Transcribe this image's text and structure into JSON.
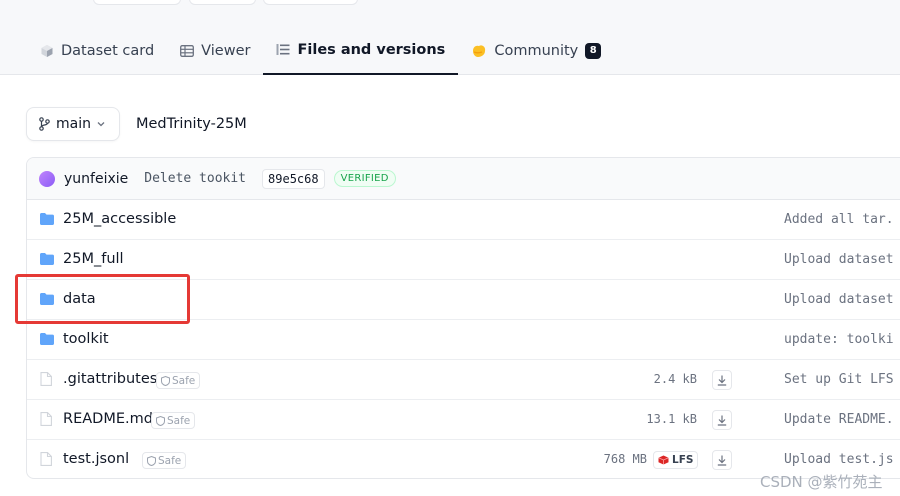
{
  "tabs": [
    {
      "label": "Dataset card",
      "icon": "dataset-card-icon",
      "active": false
    },
    {
      "label": "Viewer",
      "icon": "viewer-table-icon",
      "active": false
    },
    {
      "label": "Files and versions",
      "icon": "files-versions-icon",
      "active": true
    },
    {
      "label": "Community",
      "icon": "community-icon",
      "active": false,
      "badge": "8"
    }
  ],
  "branch": {
    "label": "main",
    "icon": "branch-icon"
  },
  "repo": {
    "name": "MedTrinity-25M"
  },
  "commit": {
    "author": "yunfeixie",
    "message": "Delete tookit",
    "hash": "89e5c68",
    "status": "VERIFIED"
  },
  "files": [
    {
      "name": "25M_accessible",
      "type": "folder",
      "message": "Added all tar."
    },
    {
      "name": "25M_full",
      "type": "folder",
      "message": "Upload dataset"
    },
    {
      "name": "data",
      "type": "folder",
      "message": "Upload dataset"
    },
    {
      "name": "toolkit",
      "type": "folder",
      "message": "update: toolki"
    },
    {
      "name": ".gitattributes",
      "type": "file",
      "safe": "Safe",
      "size": "2.4 kB",
      "message": "Set up Git LFS"
    },
    {
      "name": "README.md",
      "type": "file",
      "safe": "Safe",
      "size": "13.1 kB",
      "message": "Update README."
    },
    {
      "name": "test.jsonl",
      "type": "file",
      "safe": "Safe",
      "size": "768 MB",
      "lfs": "LFS",
      "message": "Upload test.js"
    }
  ],
  "watermark": "CSDN @紫竹苑主",
  "colors": {
    "folder": "#60a5fa",
    "highlight": "#e53935",
    "verified": "#16a34a",
    "accent": "#111827"
  }
}
